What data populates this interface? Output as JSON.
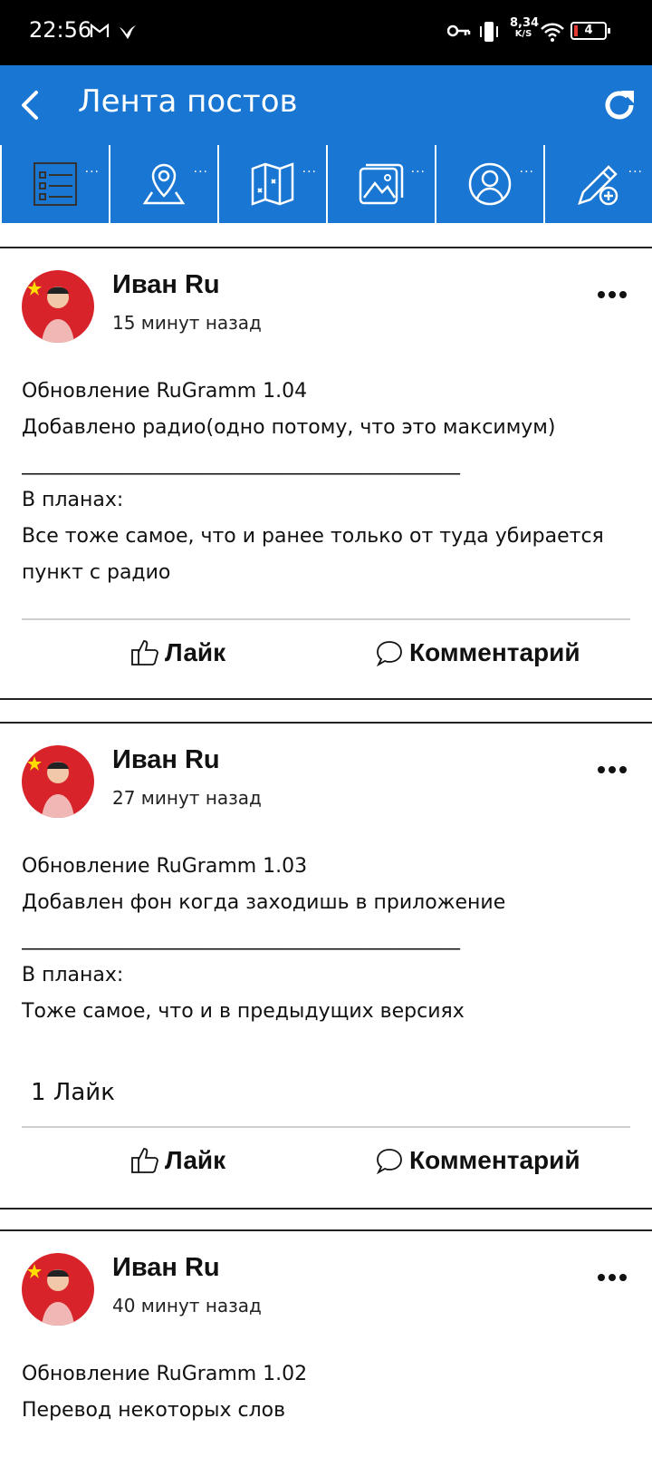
{
  "status_bar": {
    "time": "22:56",
    "network_speed_top": "8,34",
    "network_speed_unit": "K/S",
    "battery_level": "4",
    "icons": [
      "gmail-icon",
      "bird-icon",
      "key-icon",
      "vibrate-icon",
      "wifi-icon",
      "battery-icon"
    ]
  },
  "header": {
    "title": "Лента постов",
    "back_icon": "back-arrow-icon",
    "refresh_icon": "refresh-icon"
  },
  "nav": {
    "tiles": [
      {
        "icon": "list-icon",
        "dots": "..."
      },
      {
        "icon": "location-pin-icon",
        "dots": "..."
      },
      {
        "icon": "map-icon",
        "dots": "..."
      },
      {
        "icon": "gallery-icon",
        "dots": "..."
      },
      {
        "icon": "profile-icon",
        "dots": "..."
      },
      {
        "icon": "edit-pen-icon",
        "dots": "..."
      }
    ]
  },
  "actions": {
    "like_label": "Лайк",
    "comment_label": "Комментарий"
  },
  "posts": [
    {
      "author": "Иван Ru",
      "time_ago": "15 минут назад",
      "lines": [
        "Обновление RuGramm 1.04",
        "Добавлено радио(одно потому, что это максимум)",
        "____________________________________________",
        "В планах:",
        "Все тоже самое, что и ранее только от туда убирается",
        "пункт с радио"
      ]
    },
    {
      "author": "Иван Ru",
      "time_ago": "27 минут назад",
      "lines": [
        "Обновление RuGramm 1.03",
        "Добавлен фон когда заходишь в приложение",
        "____________________________________________",
        "В планах:",
        "Тоже самое, что и в предыдущих версиях"
      ],
      "likes": "1 Лайк"
    },
    {
      "author": "Иван Ru",
      "time_ago": "40 минут назад",
      "lines": [
        "Обновление RuGramm 1.02",
        "Перевод некоторых слов"
      ]
    }
  ]
}
